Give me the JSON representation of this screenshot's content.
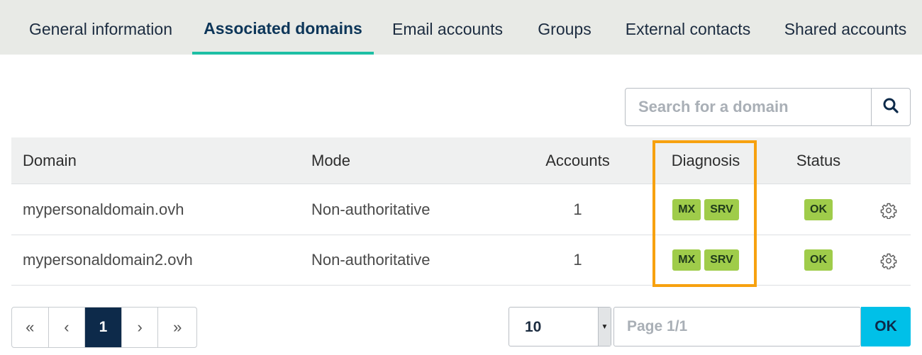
{
  "tabs": [
    {
      "label": "General information"
    },
    {
      "label": "Associated domains"
    },
    {
      "label": "Email accounts"
    },
    {
      "label": "Groups"
    },
    {
      "label": "External contacts"
    },
    {
      "label": "Shared accounts"
    }
  ],
  "active_tab": "Associated domains",
  "search": {
    "placeholder": "Search for a domain",
    "icon": "search-icon"
  },
  "table": {
    "columns": {
      "domain": "Domain",
      "mode": "Mode",
      "accounts": "Accounts",
      "diagnosis": "Diagnosis",
      "status": "Status"
    },
    "rows": [
      {
        "domain": "mypersonaldomain.ovh",
        "mode": "Non-authoritative",
        "accounts": "1",
        "diagnosis": [
          "MX",
          "SRV"
        ],
        "status": "OK",
        "action_icon": "gear-icon"
      },
      {
        "domain": "mypersonaldomain2.ovh",
        "mode": "Non-authoritative",
        "accounts": "1",
        "diagnosis": [
          "MX",
          "SRV"
        ],
        "status": "OK",
        "action_icon": "gear-icon"
      }
    ]
  },
  "pagination": {
    "first": "«",
    "prev": "‹",
    "current": "1",
    "next": "›",
    "last": "»",
    "page_size": "10",
    "page_placeholder": "Page 1/1",
    "ok_label": "OK"
  },
  "colors": {
    "accent_tab": "#1ebfa5",
    "badge": "#9fcc4a",
    "highlight": "#f7a10f",
    "pager_current": "#0d2a4a",
    "ok_button": "#00c0e8"
  }
}
